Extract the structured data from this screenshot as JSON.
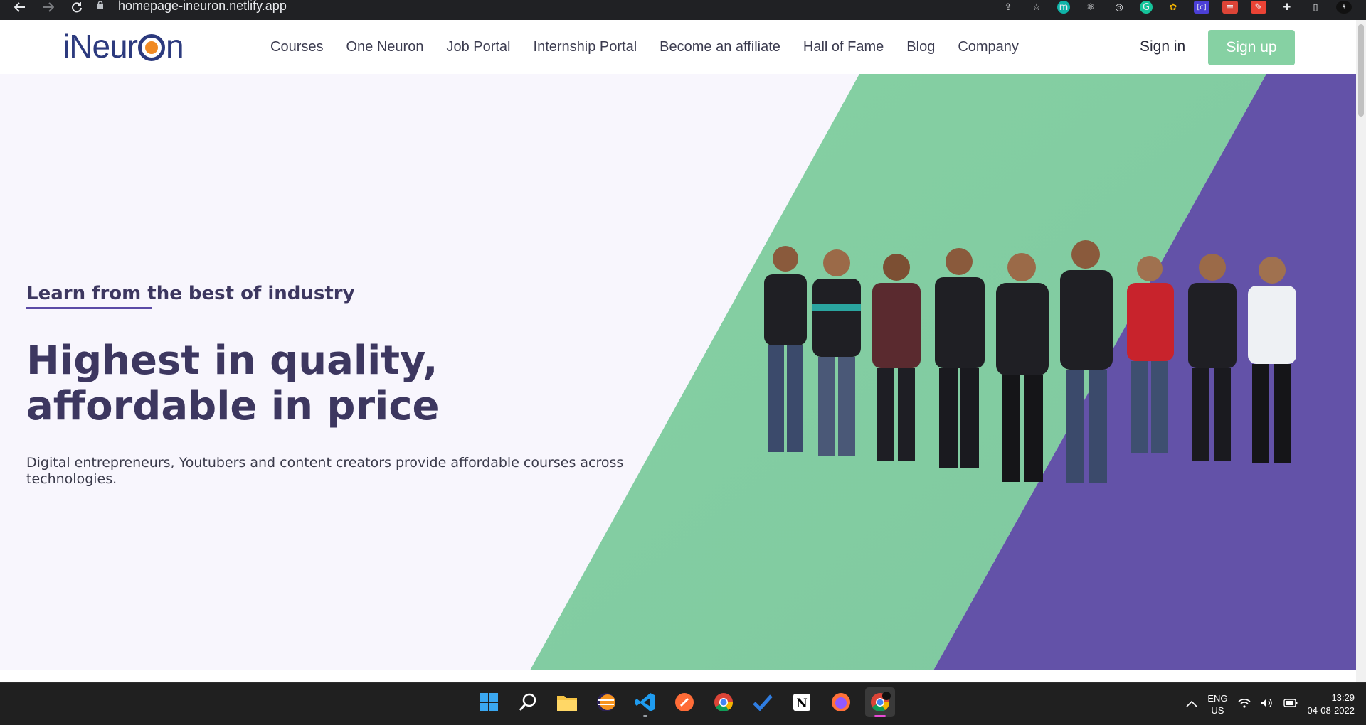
{
  "browser": {
    "url": "homepage-ineuron.netlify.app",
    "back_icon": "arrow-left-icon",
    "forward_icon": "arrow-right-icon",
    "reload_icon": "reload-icon"
  },
  "site": {
    "logo": {
      "prefix": "iNeur",
      "suffix": "n"
    },
    "nav": [
      "Courses",
      "One Neuron",
      "Job Portal",
      "Internship Portal",
      "Become an affiliate",
      "Hall of Fame",
      "Blog",
      "Company"
    ],
    "signin_label": "Sign in",
    "signup_label": "Sign up"
  },
  "hero": {
    "tagline": "Learn from the best of industry",
    "headline_line1": "Highest in quality,",
    "headline_line2": "affordable in price",
    "description": "Digital entrepreneurs, Youtubers and content creators provide affordable courses across technologies."
  },
  "colors": {
    "green": "#86d1a3",
    "purple": "#6352a8",
    "heading": "#3d3760",
    "bg": "#f8f6fd"
  },
  "taskbar": {
    "apps": [
      "windows-start-icon",
      "search-icon",
      "file-explorer-icon",
      "eclipse-icon",
      "vscode-icon",
      "postman-icon",
      "chrome-icon",
      "todo-icon",
      "notion-icon",
      "firefox-icon",
      "chrome-profile-icon"
    ],
    "lang_line1": "ENG",
    "lang_line2": "US",
    "time": "13:29",
    "date": "04-08-2022"
  }
}
